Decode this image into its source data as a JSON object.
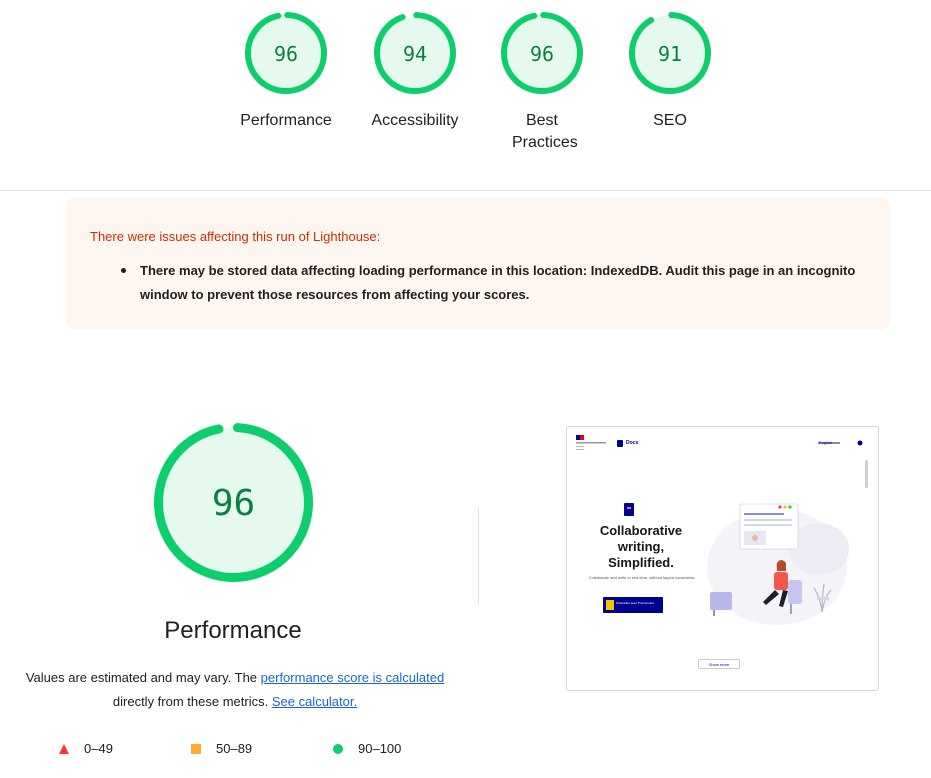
{
  "summary_gauges": [
    {
      "label": "Performance",
      "score": "96"
    },
    {
      "label": "Accessibility",
      "score": "94"
    },
    {
      "label": "Best Practices",
      "score": "96"
    },
    {
      "label": "SEO",
      "score": "91"
    }
  ],
  "warning": {
    "title": "There were issues affecting this run of Lighthouse:",
    "items": [
      "There may be stored data affecting loading performance in this location: IndexedDB. Audit this page in an incognito window to prevent those resources from affecting your scores."
    ]
  },
  "performance": {
    "score": "96",
    "title": "Performance",
    "note_prefix": "Values are estimated and may vary. The ",
    "note_link": "performance score is calculated",
    "note_middle": " directly from these metrics. ",
    "note_calc": "See calculator."
  },
  "legend": [
    {
      "range": "0–49",
      "shape": "triangle",
      "color": "#ff3333"
    },
    {
      "range": "50–89",
      "shape": "square",
      "color": "#ffaa33"
    },
    {
      "range": "90–100",
      "shape": "circle",
      "color": "#0cce6b"
    }
  ],
  "screenshot": {
    "brand": "Docs",
    "language": "English",
    "headline_1": "Collaborative",
    "headline_2": "writing,",
    "headline_3": "Simplified.",
    "subtext": "Collaborate and write in real time, without layout constraints.",
    "cta": "S'identifier avec ProConnect",
    "show_more": "Show more"
  },
  "colors": {
    "pass": "#0cce6b",
    "pass_bg": "#e5f9ef",
    "pass_text": "#0b8043",
    "warning_bg": "#fdf5f0",
    "warning_title": "#c33300",
    "link": "#1967d2"
  }
}
